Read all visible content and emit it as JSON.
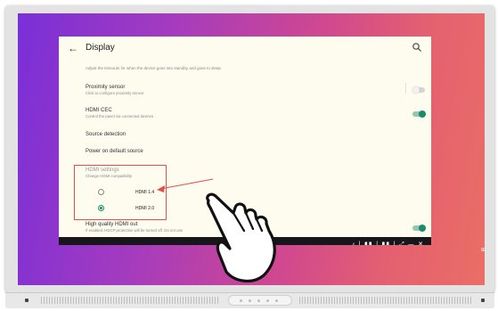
{
  "window": {
    "title": "Display",
    "back_icon": "arrow-left-icon",
    "search_icon": "search-icon"
  },
  "settings": {
    "top_description": "Adjust the timeouts for when the device goes into standby and goes to sleep",
    "proximity": {
      "title": "Proximity sensor",
      "subtitle": "Click to configure proximity sensor",
      "toggle": "off"
    },
    "hdmi_cec": {
      "title": "HDMI CEC",
      "subtitle": "Control the panel via connected devices",
      "toggle": "on"
    },
    "source_detection": {
      "title": "Source detection"
    },
    "power_on_source": {
      "title": "Power on default source"
    },
    "hdmi_settings": {
      "title": "HDMI settings",
      "subtitle": "Change HDMI compatibility",
      "options": [
        {
          "label": "HDMI 1.4",
          "selected": false
        },
        {
          "label": "HDMI 2.0",
          "selected": true
        }
      ]
    },
    "hq_hdmi": {
      "title": "High quality HDMI out",
      "subtitle": "If enabled, HDCP protection will be turned off. Do not use",
      "toggle": "on"
    }
  },
  "navbar": {
    "icons": "‹ | ▮▮ | ▮▮ | ⤢ — ✕"
  },
  "colors": {
    "accent": "#1b8a6b",
    "highlight": "#e2504a",
    "window_bg": "#fdfcef",
    "navbar_bg": "#17171b"
  }
}
